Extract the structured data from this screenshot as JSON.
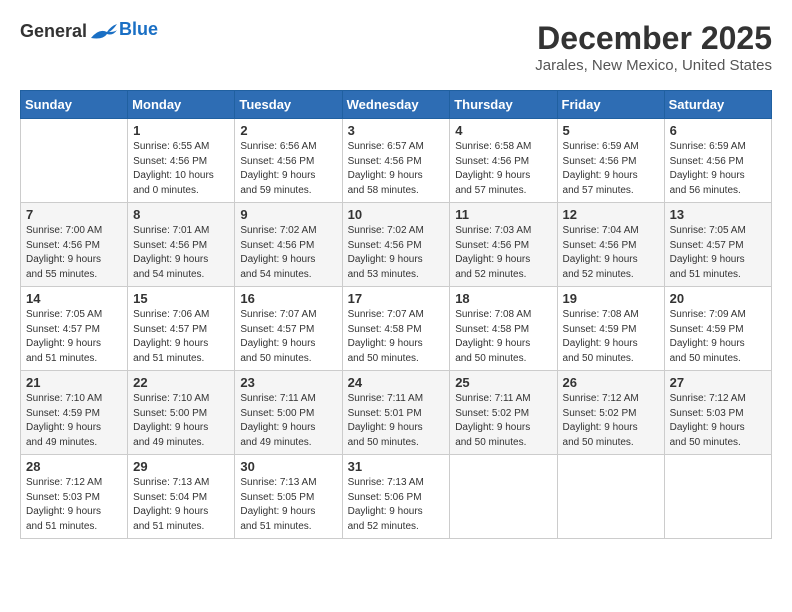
{
  "logo": {
    "general": "General",
    "blue": "Blue"
  },
  "title": {
    "month": "December 2025",
    "location": "Jarales, New Mexico, United States"
  },
  "headers": [
    "Sunday",
    "Monday",
    "Tuesday",
    "Wednesday",
    "Thursday",
    "Friday",
    "Saturday"
  ],
  "weeks": [
    [
      {
        "day": "",
        "info": ""
      },
      {
        "day": "1",
        "info": "Sunrise: 6:55 AM\nSunset: 4:56 PM\nDaylight: 10 hours\nand 0 minutes."
      },
      {
        "day": "2",
        "info": "Sunrise: 6:56 AM\nSunset: 4:56 PM\nDaylight: 9 hours\nand 59 minutes."
      },
      {
        "day": "3",
        "info": "Sunrise: 6:57 AM\nSunset: 4:56 PM\nDaylight: 9 hours\nand 58 minutes."
      },
      {
        "day": "4",
        "info": "Sunrise: 6:58 AM\nSunset: 4:56 PM\nDaylight: 9 hours\nand 57 minutes."
      },
      {
        "day": "5",
        "info": "Sunrise: 6:59 AM\nSunset: 4:56 PM\nDaylight: 9 hours\nand 57 minutes."
      },
      {
        "day": "6",
        "info": "Sunrise: 6:59 AM\nSunset: 4:56 PM\nDaylight: 9 hours\nand 56 minutes."
      }
    ],
    [
      {
        "day": "7",
        "info": "Sunrise: 7:00 AM\nSunset: 4:56 PM\nDaylight: 9 hours\nand 55 minutes."
      },
      {
        "day": "8",
        "info": "Sunrise: 7:01 AM\nSunset: 4:56 PM\nDaylight: 9 hours\nand 54 minutes."
      },
      {
        "day": "9",
        "info": "Sunrise: 7:02 AM\nSunset: 4:56 PM\nDaylight: 9 hours\nand 54 minutes."
      },
      {
        "day": "10",
        "info": "Sunrise: 7:02 AM\nSunset: 4:56 PM\nDaylight: 9 hours\nand 53 minutes."
      },
      {
        "day": "11",
        "info": "Sunrise: 7:03 AM\nSunset: 4:56 PM\nDaylight: 9 hours\nand 52 minutes."
      },
      {
        "day": "12",
        "info": "Sunrise: 7:04 AM\nSunset: 4:56 PM\nDaylight: 9 hours\nand 52 minutes."
      },
      {
        "day": "13",
        "info": "Sunrise: 7:05 AM\nSunset: 4:57 PM\nDaylight: 9 hours\nand 51 minutes."
      }
    ],
    [
      {
        "day": "14",
        "info": "Sunrise: 7:05 AM\nSunset: 4:57 PM\nDaylight: 9 hours\nand 51 minutes."
      },
      {
        "day": "15",
        "info": "Sunrise: 7:06 AM\nSunset: 4:57 PM\nDaylight: 9 hours\nand 51 minutes."
      },
      {
        "day": "16",
        "info": "Sunrise: 7:07 AM\nSunset: 4:57 PM\nDaylight: 9 hours\nand 50 minutes."
      },
      {
        "day": "17",
        "info": "Sunrise: 7:07 AM\nSunset: 4:58 PM\nDaylight: 9 hours\nand 50 minutes."
      },
      {
        "day": "18",
        "info": "Sunrise: 7:08 AM\nSunset: 4:58 PM\nDaylight: 9 hours\nand 50 minutes."
      },
      {
        "day": "19",
        "info": "Sunrise: 7:08 AM\nSunset: 4:59 PM\nDaylight: 9 hours\nand 50 minutes."
      },
      {
        "day": "20",
        "info": "Sunrise: 7:09 AM\nSunset: 4:59 PM\nDaylight: 9 hours\nand 50 minutes."
      }
    ],
    [
      {
        "day": "21",
        "info": "Sunrise: 7:10 AM\nSunset: 4:59 PM\nDaylight: 9 hours\nand 49 minutes."
      },
      {
        "day": "22",
        "info": "Sunrise: 7:10 AM\nSunset: 5:00 PM\nDaylight: 9 hours\nand 49 minutes."
      },
      {
        "day": "23",
        "info": "Sunrise: 7:11 AM\nSunset: 5:00 PM\nDaylight: 9 hours\nand 49 minutes."
      },
      {
        "day": "24",
        "info": "Sunrise: 7:11 AM\nSunset: 5:01 PM\nDaylight: 9 hours\nand 50 minutes."
      },
      {
        "day": "25",
        "info": "Sunrise: 7:11 AM\nSunset: 5:02 PM\nDaylight: 9 hours\nand 50 minutes."
      },
      {
        "day": "26",
        "info": "Sunrise: 7:12 AM\nSunset: 5:02 PM\nDaylight: 9 hours\nand 50 minutes."
      },
      {
        "day": "27",
        "info": "Sunrise: 7:12 AM\nSunset: 5:03 PM\nDaylight: 9 hours\nand 50 minutes."
      }
    ],
    [
      {
        "day": "28",
        "info": "Sunrise: 7:12 AM\nSunset: 5:03 PM\nDaylight: 9 hours\nand 51 minutes."
      },
      {
        "day": "29",
        "info": "Sunrise: 7:13 AM\nSunset: 5:04 PM\nDaylight: 9 hours\nand 51 minutes."
      },
      {
        "day": "30",
        "info": "Sunrise: 7:13 AM\nSunset: 5:05 PM\nDaylight: 9 hours\nand 51 minutes."
      },
      {
        "day": "31",
        "info": "Sunrise: 7:13 AM\nSunset: 5:06 PM\nDaylight: 9 hours\nand 52 minutes."
      },
      {
        "day": "",
        "info": ""
      },
      {
        "day": "",
        "info": ""
      },
      {
        "day": "",
        "info": ""
      }
    ]
  ]
}
